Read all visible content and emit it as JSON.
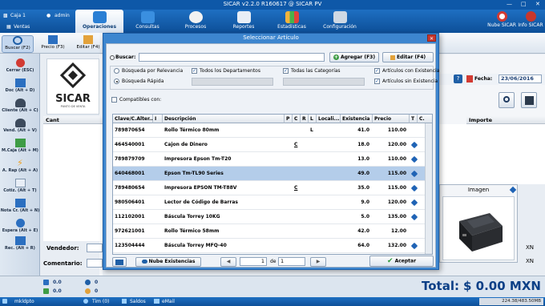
{
  "window": {
    "title": "SICAR v2.2.0 R160617 @ SICAR PV"
  },
  "ribbon": {
    "caja": "Caja 1",
    "user": "admin",
    "ventas": "Ventas",
    "tabs": [
      {
        "label": "Operaciones",
        "icon": "cart-icon"
      },
      {
        "label": "Consultas",
        "icon": "monitor-icon"
      },
      {
        "label": "Procesos",
        "icon": "gears-icon"
      },
      {
        "label": "Reportes",
        "icon": "document-icon"
      },
      {
        "label": "Estadísticas",
        "icon": "chart-icon"
      },
      {
        "label": "Configuración",
        "icon": "tools-icon"
      }
    ],
    "nube": "Nube SICAR",
    "info": "Info SICAR"
  },
  "subtoolbar": [
    {
      "label": "Buscar (F2)",
      "icon": "search-icon"
    },
    {
      "label": "Precio (F3)",
      "icon": "price-icon"
    },
    {
      "label": "Editar (F4)",
      "icon": "edit-icon"
    }
  ],
  "sidebar": [
    {
      "label": "Cerrar (ESC)",
      "icon": "power-icon"
    },
    {
      "label": "Doc (Alt + D)",
      "icon": "doc-icon"
    },
    {
      "label": "Cliente (Alt + C)",
      "icon": "client-icon"
    },
    {
      "label": "Vend. (Alt + V)",
      "icon": "seller-icon"
    },
    {
      "label": "M.Caja (Alt + M)",
      "icon": "cashbox-icon"
    },
    {
      "label": "A. Rap (Alt + A)",
      "icon": "lightning-icon"
    },
    {
      "label": "Cotiz. (Alt + T)",
      "icon": "quote-icon"
    },
    {
      "label": "Nota Cr. (Alt + N)",
      "icon": "credit-note-icon"
    },
    {
      "label": "Espera (Alt + E)",
      "icon": "wait-icon"
    },
    {
      "label": "Rec. (Alt + R)",
      "icon": "receipt-icon"
    }
  ],
  "main": {
    "logo_text": "SICAR",
    "logo_sub": "PUNTO DE VENTA",
    "fecha_label": "Fecha:",
    "fecha": "23/06/2016",
    "col_cant": "Cant",
    "col_importe": "Importe",
    "vendedor_label": "Vendedor:",
    "comentario_label": "Comentario:",
    "mxn1": "XN",
    "mxn2": "XN",
    "total_label": "Total:",
    "total_value": "$ 0.00 MXN",
    "bottom_vals": [
      "0.0",
      "0.0",
      "0",
      "0"
    ]
  },
  "dialog": {
    "title": "Seleccionar Artículo",
    "buscar_label": "Buscar:",
    "buscar_value": "",
    "agregar": "Agregar (F3)",
    "editar": "Editar (F4)",
    "opt_relevancia": "Búsqueda por Relevancia",
    "opt_rapida": "Búsqueda Rápida",
    "todos_deptos": "Todos los Departamentos",
    "todas_cats": "Todas las Categorías",
    "con_existencia": "Artículos con Existencia",
    "sin_existencia": "Artículos sin Existencia",
    "compatibles": "Compatibles con:",
    "columns": [
      "Clave/C.Alter...",
      "I",
      "Descripción",
      "P",
      "C",
      "R",
      "L",
      "Locali...",
      "Existencia",
      "Precio",
      "T",
      "C."
    ],
    "rows": [
      {
        "clave": "789870654",
        "desc": "Rollo Térmico 80mm",
        "p": "",
        "c": "",
        "r": "",
        "l": "L",
        "exist": "41.0",
        "precio": "110.00",
        "tag": false
      },
      {
        "clave": "464540001",
        "desc": "Cajon de Dinero",
        "p": "",
        "c": "C",
        "r": "",
        "l": "",
        "exist": "18.0",
        "precio": "120.00",
        "tag": true
      },
      {
        "clave": "789879709",
        "desc": "Impresora Epson Tm-T20",
        "p": "",
        "c": "",
        "r": "",
        "l": "",
        "exist": "13.0",
        "precio": "110.00",
        "tag": true
      },
      {
        "clave": "640468001",
        "desc": "Epson Tm-TL90 Series",
        "p": "",
        "c": "",
        "r": "",
        "l": "",
        "exist": "49.0",
        "precio": "115.00",
        "tag": true
      },
      {
        "clave": "789480654",
        "desc": "Impresora EPSON TM-T88V",
        "p": "",
        "c": "C",
        "r": "",
        "l": "",
        "exist": "35.0",
        "precio": "115.00",
        "tag": true
      },
      {
        "clave": "980506401",
        "desc": "Lector de Código de Barras",
        "p": "",
        "c": "",
        "r": "",
        "l": "",
        "exist": "9.0",
        "precio": "120.00",
        "tag": true
      },
      {
        "clave": "112102001",
        "desc": "Báscula Torrey 10KG",
        "p": "",
        "c": "",
        "r": "",
        "l": "",
        "exist": "5.0",
        "precio": "135.00",
        "tag": true
      },
      {
        "clave": "972621001",
        "desc": "Rollo Térmico 58mm",
        "p": "",
        "c": "",
        "r": "",
        "l": "",
        "exist": "42.0",
        "precio": "12.00",
        "tag": false
      },
      {
        "clave": "123504444",
        "desc": "Báscula Torrey MFQ-40",
        "p": "",
        "c": "",
        "r": "",
        "l": "",
        "exist": "64.0",
        "precio": "132.00",
        "tag": true
      }
    ],
    "nube_existencias": "Nube Existencias",
    "page_current": "1",
    "page_of": "de",
    "page_total": "1",
    "aceptar": "Aceptar"
  },
  "image_panel": {
    "title": "Imagen"
  },
  "statusbar": {
    "user": "mkldpto",
    "tim": "Tim (0)",
    "saldos": "Saldos",
    "email": "eMail",
    "memory": "224.38/483.50MB"
  },
  "colors": {
    "brand_blue": "#0e58a8",
    "selected_row": "#b4cdea",
    "total_blue": "#0b3f86"
  }
}
